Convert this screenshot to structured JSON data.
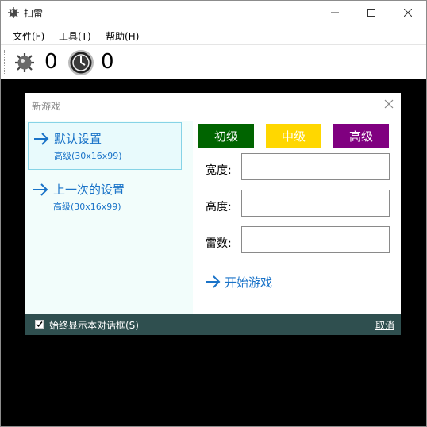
{
  "window": {
    "title": "扫雷"
  },
  "menu": {
    "items": [
      "文件(F)",
      "工具(T)",
      "帮助(H)"
    ]
  },
  "toolbar": {
    "mines_count": "0",
    "time_count": "0"
  },
  "dialog": {
    "title": "新游戏",
    "options": [
      {
        "label": "默认设置",
        "sub": "高级(30x16x99)",
        "selected": true
      },
      {
        "label": "上一次的设置",
        "sub": "高级(30x16x99)",
        "selected": false
      }
    ],
    "levels": [
      {
        "label": "初级",
        "color": "#006400"
      },
      {
        "label": "中级",
        "color": "#ffd700"
      },
      {
        "label": "高级",
        "color": "#800080"
      }
    ],
    "fields": {
      "width_label": "宽度:",
      "width_value": "",
      "height_label": "高度:",
      "height_value": "",
      "mines_label": "雷数:",
      "mines_value": ""
    },
    "start_label": "开始游戏",
    "footer": {
      "checkbox_label": "始终显示本对话框(S)",
      "checked": true,
      "cancel_label": "取消"
    }
  },
  "colors": {
    "link": "#1a73c8",
    "footer_bg": "#2f4f4f",
    "left_panel_bg": "#f2fdfb",
    "game_bg": "#000000"
  }
}
